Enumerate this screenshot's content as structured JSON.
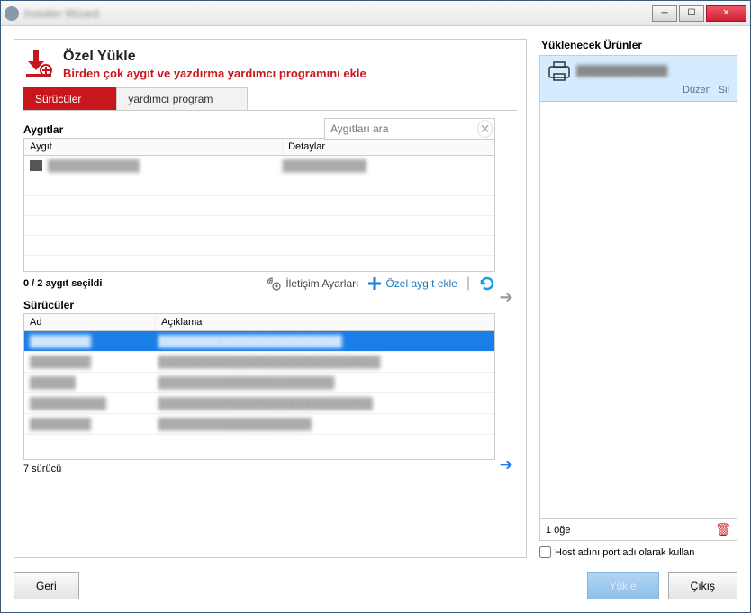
{
  "window": {
    "title": "Installer Wizard"
  },
  "header": {
    "title": "Özel Yükle",
    "subtitle": "Birden çok aygıt ve yazdırma yardımcı programını ekle"
  },
  "tabs": {
    "drivers": "Sürücüler",
    "utility": "yardımcı program"
  },
  "devices": {
    "section": "Aygıtlar",
    "search_placeholder": "Aygıtları ara",
    "col_device": "Aygıt",
    "col_details": "Detaylar",
    "status": "0 / 2 aygıt seçildi",
    "comm_settings": "İletişim Ayarları",
    "add_custom": "Özel aygıt ekle"
  },
  "drivers": {
    "section": "Sürücüler",
    "col_name": "Ad",
    "col_desc": "Açıklama",
    "count": "7 sürücü"
  },
  "right": {
    "title": "Yüklenecek Ürünler",
    "edit": "Düzen",
    "delete": "Sil",
    "footer_count": "1 öğe",
    "hostname_checkbox": "Host adını port adı olarak kullan"
  },
  "buttons": {
    "back": "Geri",
    "install": "Yükle",
    "exit": "Çıkış"
  }
}
